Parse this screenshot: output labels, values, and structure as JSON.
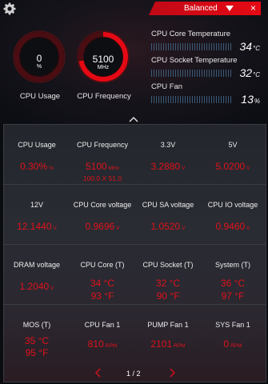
{
  "header": {
    "profile": "Balanced",
    "close_glyph": "×"
  },
  "gauges": [
    {
      "value": "0",
      "unit": "%",
      "label": "CPU Usage",
      "percent": 0
    },
    {
      "value": "5100",
      "unit": "MHz",
      "label": "CPU Frequency",
      "percent": 72
    }
  ],
  "monitors": [
    {
      "label": "CPU Core Temperature",
      "value": "34",
      "unit": "°C"
    },
    {
      "label": "CPU Socket Temperature",
      "value": "32",
      "unit": "°C"
    },
    {
      "label": "CPU Fan",
      "value": "13",
      "unit": "%"
    }
  ],
  "grid": [
    [
      {
        "title": "CPU Usage",
        "value": "0.30%",
        "unit": "%"
      },
      {
        "title": "CPU Frequency",
        "value": "5100",
        "unit": "MHz",
        "sub": "100.0 X 51.0"
      },
      {
        "title": "3.3V",
        "value": "3.2880",
        "unit": "V"
      },
      {
        "title": "5V",
        "value": "5.0200",
        "unit": "V"
      }
    ],
    [
      {
        "title": "12V",
        "value": "12.1440",
        "unit": "V"
      },
      {
        "title": "CPU Core voltage",
        "value": "0.9696",
        "unit": "V"
      },
      {
        "title": "CPU SA voltage",
        "value": "1.0520",
        "unit": "V"
      },
      {
        "title": "CPU IO voltage",
        "value": "0.9460",
        "unit": "V"
      }
    ],
    [
      {
        "title": "DRAM voltage",
        "value": "1.2040",
        "unit": "V"
      },
      {
        "title": "CPU Core (T)",
        "value": "34 °C",
        "sub": "93 °F"
      },
      {
        "title": "CPU Socket (T)",
        "value": "32 °C",
        "sub": "90 °F"
      },
      {
        "title": "System (T)",
        "value": "36 °C",
        "sub": "97 °F"
      }
    ],
    [
      {
        "title": "MOS (T)",
        "value": "35 °C",
        "sub": "95 °F"
      },
      {
        "title": "CPU Fan 1",
        "value": "810",
        "unit": "RPM"
      },
      {
        "title": "PUMP Fan 1",
        "value": "2101",
        "unit": "RPM"
      },
      {
        "title": "SYS Fan 1",
        "value": "0",
        "unit": "RPM"
      }
    ]
  ],
  "pager": {
    "text": "1 / 2"
  },
  "colors": {
    "accent": "#e0121c",
    "header_red": "#e50914",
    "bar_blue": "#3c5c78"
  },
  "icons": [
    "gear-icon",
    "chevron-down-icon",
    "close-icon",
    "chevron-up-icon",
    "chevron-left-icon",
    "chevron-right-icon"
  ]
}
